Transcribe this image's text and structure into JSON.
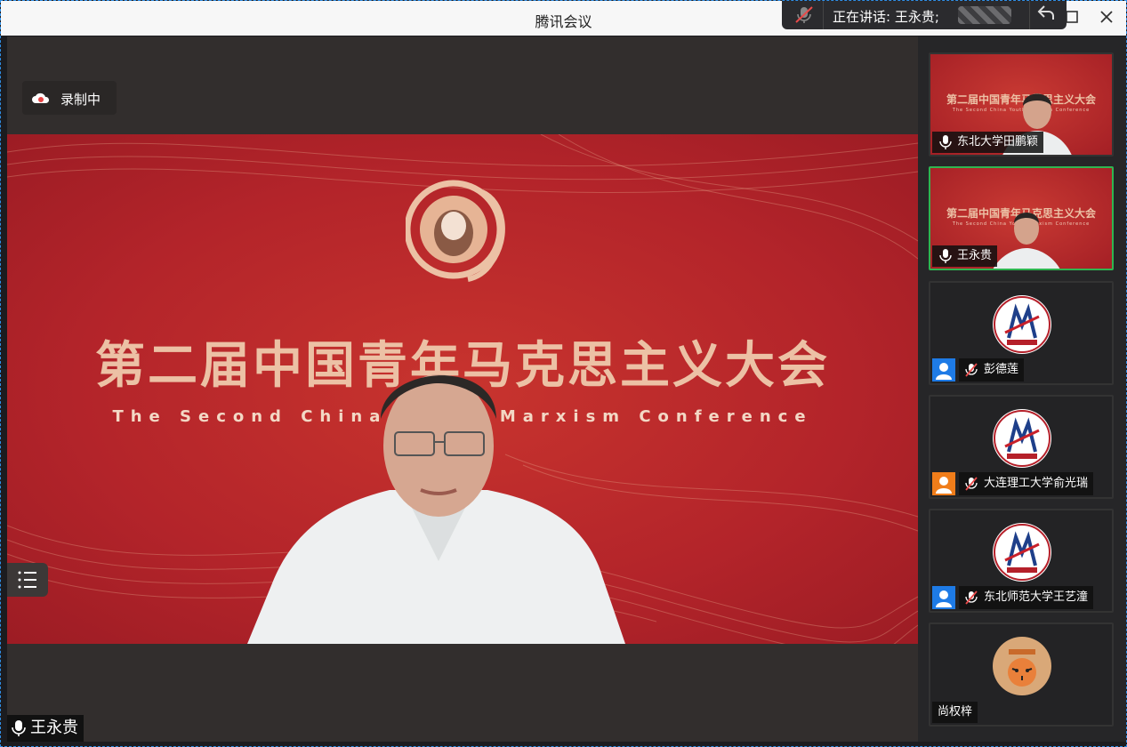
{
  "window": {
    "title": "腾讯会议"
  },
  "speaking_bar": {
    "label": "正在讲话: 王永贵;"
  },
  "recording": {
    "label": "录制中"
  },
  "slide": {
    "title": "第二届中国青年马克思主义大会",
    "subtitle": "The Second China Youth Marxism Conference"
  },
  "main_speaker": {
    "name": "王永贵"
  },
  "participants": [
    {
      "name": "东北大学田鹏颖",
      "mic": "on",
      "video": true
    },
    {
      "name": "王永贵",
      "mic": "on",
      "video": true,
      "active": true
    },
    {
      "name": "彭德莲",
      "mic": "muted",
      "avatar_color": "#1e7be6"
    },
    {
      "name": "大连理工大学俞光瑞",
      "mic": "muted",
      "avatar_color": "#f07d1a"
    },
    {
      "name": "东北师范大学王艺潼",
      "mic": "muted",
      "avatar_color": "#1e7be6"
    },
    {
      "name": "尚权梓",
      "mic": "none"
    }
  ],
  "thumb_slide": {
    "title": "第二届中国青年马克思主义大会",
    "subtitle": "The Second China Youth Marxism Conference"
  },
  "colors": {
    "accent_active": "#2fb551",
    "slide_red": "#b3242a",
    "slide_gold": "#ecc1a5"
  }
}
